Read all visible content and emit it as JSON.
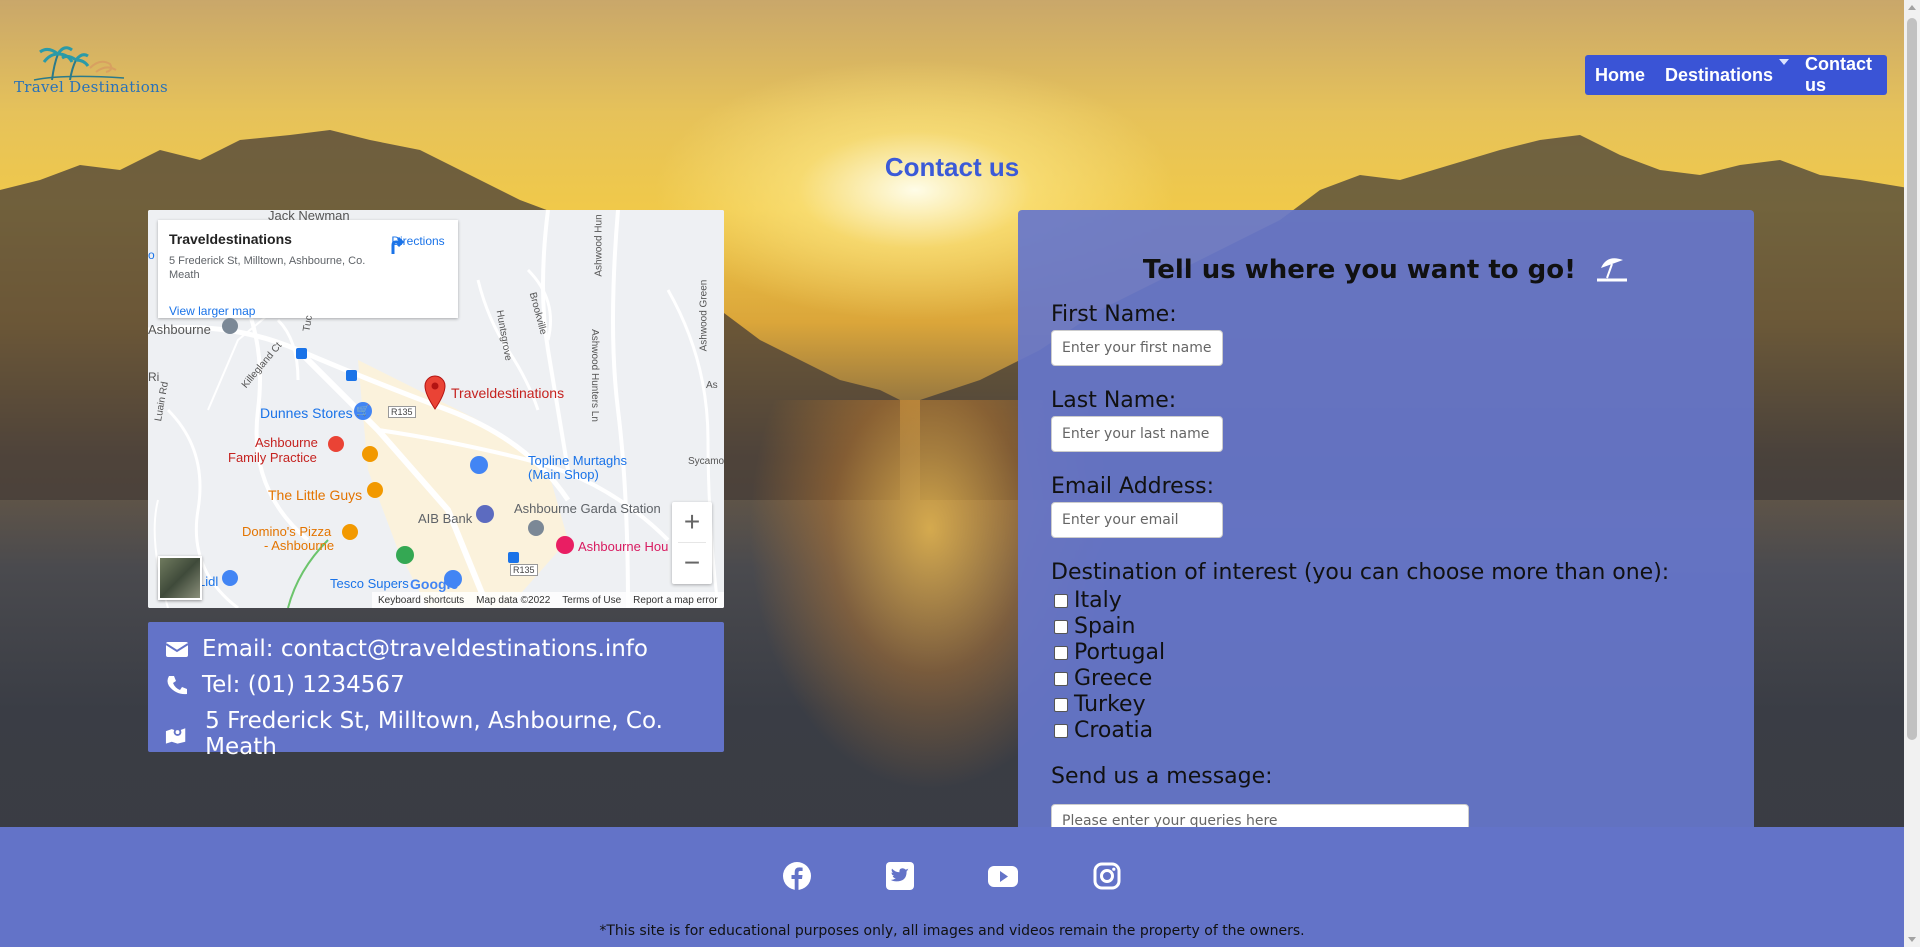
{
  "brand": {
    "logo_text": "Travel Destinations",
    "accent": "#3a54d6",
    "panel": "#6373c8"
  },
  "nav": {
    "items": [
      {
        "label": "Home"
      },
      {
        "label": "Destinations"
      },
      {
        "label": "Contact us"
      }
    ]
  },
  "page": {
    "title": "Contact us"
  },
  "map": {
    "place_name": "Traveldestinations",
    "place_address": "5 Frederick St, Milltown, Ashbourne, Co. Meath",
    "directions": "Directions",
    "larger_map": "View larger map",
    "pin_label": "Traveldestinations",
    "labels": {
      "jack_newman": "Jack Newman",
      "ashbourne": "Ashbourne",
      "dunnes": "Dunnes Stores",
      "family_practice_1": "Ashbourne",
      "family_practice_2": "Family Practice",
      "little_guys": "The Little Guys",
      "dominos_1": "Domino's Pizza",
      "dominos_2": "- Ashbourne",
      "topline_1": "Topline Murtaghs",
      "topline_2": "(Main Shop)",
      "aib": "AIB Bank",
      "garda": "Ashbourne Garda Station",
      "ashbourne_hou": "Ashbourne Hou",
      "tesco": "Tesco Supers",
      "lidl": "Lidl",
      "r135_a": "R135",
      "r135_b": "R135",
      "huntsgrove": "Huntsgrove",
      "killegland": "Killegland Ct",
      "brookville": "Brookville",
      "ashwood_hunters": "Ashwood Hunters Ln",
      "ashwood_green": "Ashwood Green",
      "ashwood_hun": "Ashwood Hun",
      "sycamore": "Sycamo",
      "luain": "Luain Rd",
      "tuc": "Tuc",
      "as": "As",
      "o": "o",
      "ri": "Ri",
      "google": "Google"
    },
    "footer": {
      "shortcuts": "Keyboard shortcuts",
      "data": "Map data ©2022",
      "terms": "Terms of Use",
      "report": "Report a map error"
    }
  },
  "contact": {
    "email": "Email: contact@traveldestinations.info",
    "tel": "Tel: (01) 1234567",
    "address": "5 Frederick St, Milltown, Ashbourne, Co. Meath"
  },
  "form": {
    "heading": "Tell us where you want to go!",
    "first_name_label": "First Name:",
    "first_name_placeholder": "Enter your first name",
    "last_name_label": "Last Name:",
    "last_name_placeholder": "Enter your last name",
    "email_label": "Email Address:",
    "email_placeholder": "Enter your email",
    "destinations_label": "Destination of interest (you can choose more than one):",
    "destinations": [
      "Italy",
      "Spain",
      "Portugal",
      "Greece",
      "Turkey",
      "Croatia"
    ],
    "message_label": "Send us a message:",
    "message_placeholder": "Please enter your queries here"
  },
  "footer": {
    "disclaimer": "*This site is for educational purposes only, all images and videos remain the property of the owners.",
    "social": [
      "facebook-icon",
      "twitter-icon",
      "youtube-icon",
      "instagram-icon"
    ]
  }
}
